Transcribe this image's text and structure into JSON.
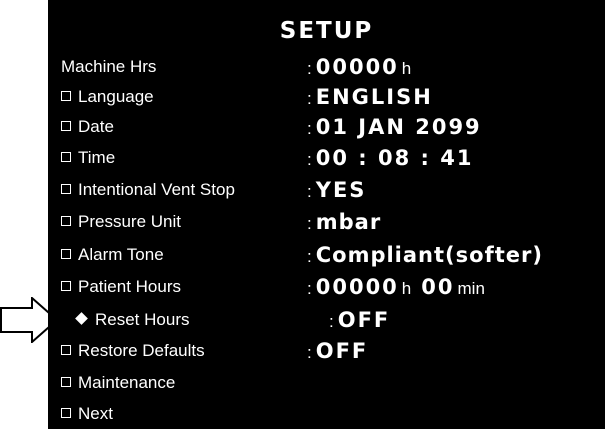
{
  "setup": {
    "title": "SETUP",
    "colon": ":",
    "rows": {
      "machine_hrs": {
        "label": "Machine Hrs",
        "value": "00000",
        "unit": "h"
      },
      "language": {
        "label": "Language",
        "value": "ENGLISH"
      },
      "date": {
        "label": "Date",
        "value": "01 JAN 2099"
      },
      "time": {
        "label": "Time",
        "value": "00 : 08 : 41"
      },
      "vent_stop": {
        "label": "Intentional Vent Stop",
        "value": "YES"
      },
      "pressure_unit": {
        "label": "Pressure Unit",
        "value": "mbar"
      },
      "alarm_tone": {
        "label": "Alarm Tone",
        "value": "Compliant(softer)"
      },
      "patient_hours": {
        "label": "Patient Hours",
        "hours_value": "00000",
        "hours_unit": "h",
        "min_value": "00",
        "min_unit": "min"
      },
      "reset_hours": {
        "label": "Reset Hours",
        "value": "OFF"
      },
      "restore_defaults": {
        "label": "Restore Defaults",
        "value": "OFF"
      },
      "maintenance": {
        "label": "Maintenance"
      },
      "next": {
        "label": "Next"
      }
    }
  },
  "colors": {
    "screen_bg": "#000000",
    "text": "#ffffff",
    "page_bg": "#ffffff",
    "arrow_outline": "#000000"
  },
  "icons": {
    "pointer": "right-arrow-outline-icon",
    "checkbox": "checkbox-icon",
    "selection": "diamond-bullet-icon"
  }
}
